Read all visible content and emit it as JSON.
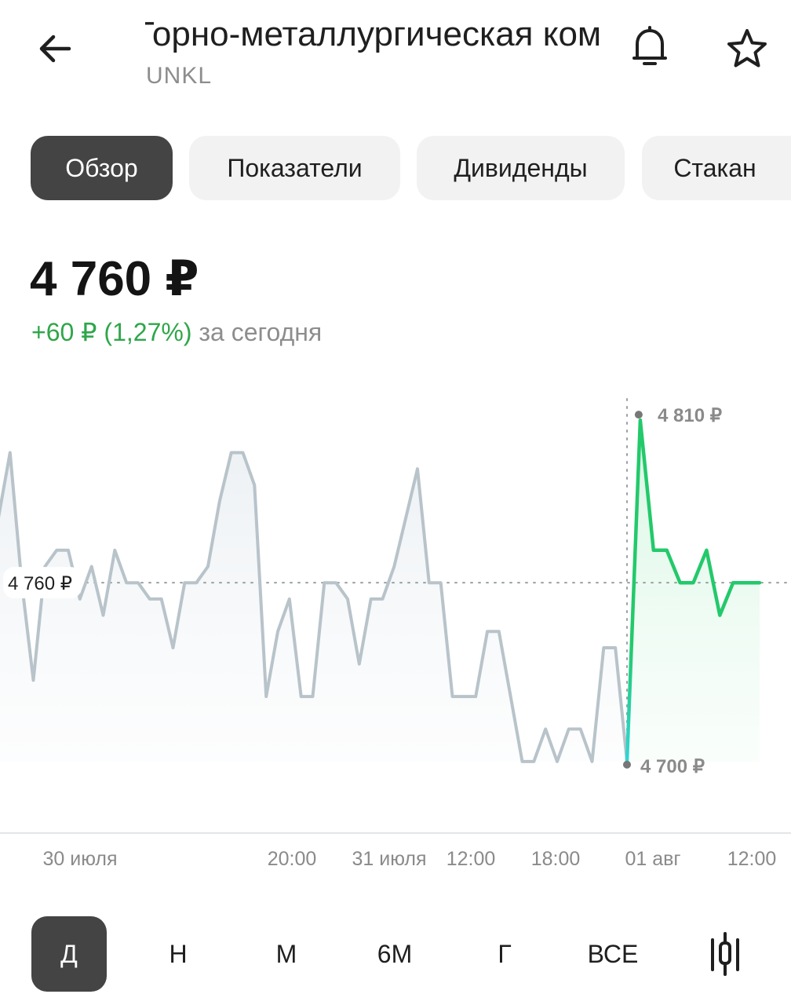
{
  "header": {
    "title": "Горно-металлургическая компания Южуралникель Комбинат Южуралникель",
    "ticker": "UNKL"
  },
  "tabs": [
    {
      "label": "Обзор",
      "active": true
    },
    {
      "label": "Показатели",
      "active": false
    },
    {
      "label": "Дивиденды",
      "active": false
    },
    {
      "label": "Стакан",
      "active": false
    }
  ],
  "quote": {
    "price": "4 760 ₽",
    "change": "+60 ₽ (1,27%)",
    "change_suffix": "за сегодня"
  },
  "colors": {
    "up": "#2fa64a",
    "line_past": "#b8c3ca",
    "line_today": "#23c96b",
    "line_today_start": "#2fd6d6",
    "muted": "#8d8d8d",
    "active_bg": "#444444"
  },
  "chart_data": {
    "type": "line",
    "current_label": "4 760 ₽",
    "max_label": "4 810 ₽",
    "min_label": "4 700 ₽",
    "current_value": 4760,
    "ylim": [
      4690,
      4818
    ],
    "x_labels": [
      "30 июля",
      "20:00",
      "31 июля",
      "12:00",
      "18:00",
      "01 авг",
      "12:00"
    ],
    "series": [
      {
        "segment": "past",
        "values": [
          4780,
          4800,
          4760,
          4730,
          4765,
          4770,
          4770,
          4755,
          4765,
          4750,
          4770,
          4760,
          4760,
          4755,
          4755,
          4740,
          4760,
          4760,
          4765,
          4785,
          4800,
          4800,
          4790,
          4725,
          4745,
          4755,
          4725,
          4725,
          4760,
          4760,
          4755,
          4735,
          4755,
          4755,
          4765,
          4780,
          4795,
          4760,
          4760,
          4725,
          4725,
          4725,
          4745,
          4745,
          4725,
          4705,
          4705,
          4715,
          4705,
          4715,
          4715,
          4705,
          4740,
          4740,
          4705
        ]
      },
      {
        "segment": "today",
        "values": [
          4705,
          4810,
          4770,
          4770,
          4760,
          4760,
          4770,
          4750,
          4760,
          4760,
          4760
        ]
      }
    ]
  },
  "periods": [
    {
      "label": "Д",
      "active": true
    },
    {
      "label": "Н",
      "active": false
    },
    {
      "label": "М",
      "active": false
    },
    {
      "label": "6М",
      "active": false
    },
    {
      "label": "Г",
      "active": false
    },
    {
      "label": "ВСЕ",
      "active": false
    }
  ],
  "icons": {
    "back": "arrow-left-icon",
    "bell": "bell-icon",
    "star": "star-icon",
    "candles": "candlestick-icon"
  }
}
